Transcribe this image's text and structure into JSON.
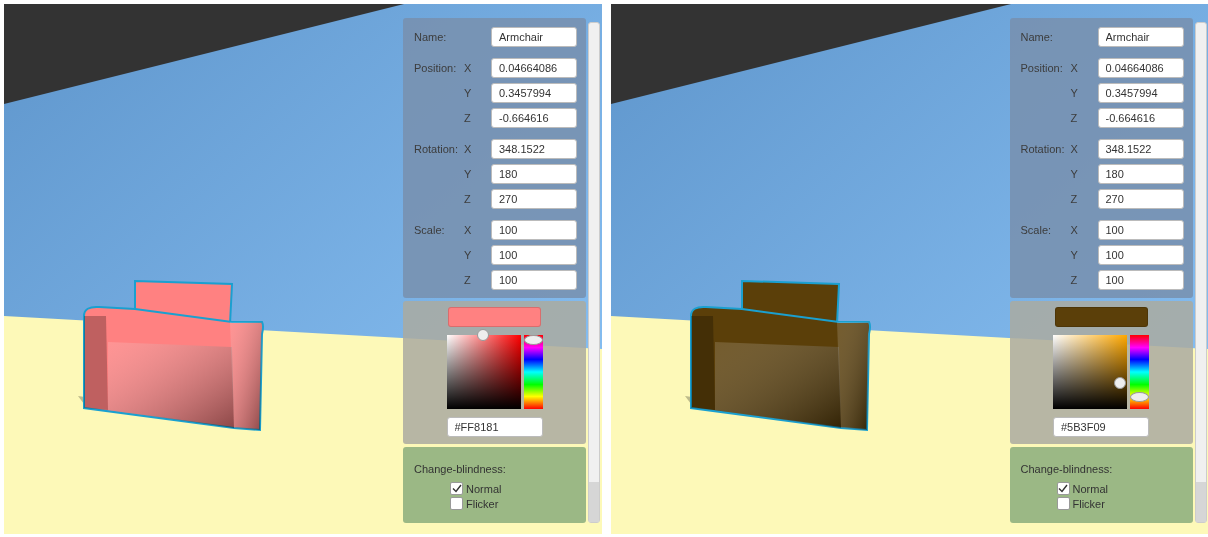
{
  "views": [
    {
      "object": {
        "label": "Name:",
        "value": "Armchair"
      },
      "groups": [
        {
          "label": "Position:",
          "fields": [
            {
              "axis": "X",
              "value": "0.04664086"
            },
            {
              "axis": "Y",
              "value": "0.3457994"
            },
            {
              "axis": "Z",
              "value": "-0.664616"
            }
          ]
        },
        {
          "label": "Rotation:",
          "fields": [
            {
              "axis": "X",
              "value": "348.1522"
            },
            {
              "axis": "Y",
              "value": "180"
            },
            {
              "axis": "Z",
              "value": "270"
            }
          ]
        },
        {
          "label": "Scale:",
          "fields": [
            {
              "axis": "X",
              "value": "100"
            },
            {
              "axis": "Y",
              "value": "100"
            },
            {
              "axis": "Z",
              "value": "100"
            }
          ]
        }
      ],
      "color": {
        "color": "#ff8181",
        "hue": {
          "level": 1
        },
        "hex": "#FF8181"
      },
      "change_blindness": {
        "label": "Change-blindness:",
        "options": [
          {
            "label": "Normal",
            "checked": true
          },
          {
            "label": "Flicker",
            "checked": false
          }
        ]
      }
    },
    {
      "object": {
        "label": "Name:",
        "value": "Armchair"
      },
      "groups": [
        {
          "label": "Position:",
          "fields": [
            {
              "axis": "X",
              "value": "0.04664086"
            },
            {
              "axis": "Y",
              "value": "0.3457994"
            },
            {
              "axis": "Z",
              "value": "-0.664616"
            }
          ]
        },
        {
          "label": "Rotation:",
          "fields": [
            {
              "axis": "X",
              "value": "348.1522"
            },
            {
              "axis": "Y",
              "value": "180"
            },
            {
              "axis": "Z",
              "value": "270"
            }
          ]
        },
        {
          "label": "Scale:",
          "fields": [
            {
              "axis": "X",
              "value": "100"
            },
            {
              "axis": "Y",
              "value": "100"
            },
            {
              "axis": "Z",
              "value": "100"
            }
          ]
        }
      ],
      "color": {
        "color": "#5b3f09",
        "hue": {
          "level": 0.11
        },
        "hex": "#5B3F09"
      },
      "change_blindness": {
        "label": "Change-blindness:",
        "options": [
          {
            "label": "Normal",
            "checked": true
          },
          {
            "label": "Flicker",
            "checked": false
          }
        ]
      }
    }
  ]
}
